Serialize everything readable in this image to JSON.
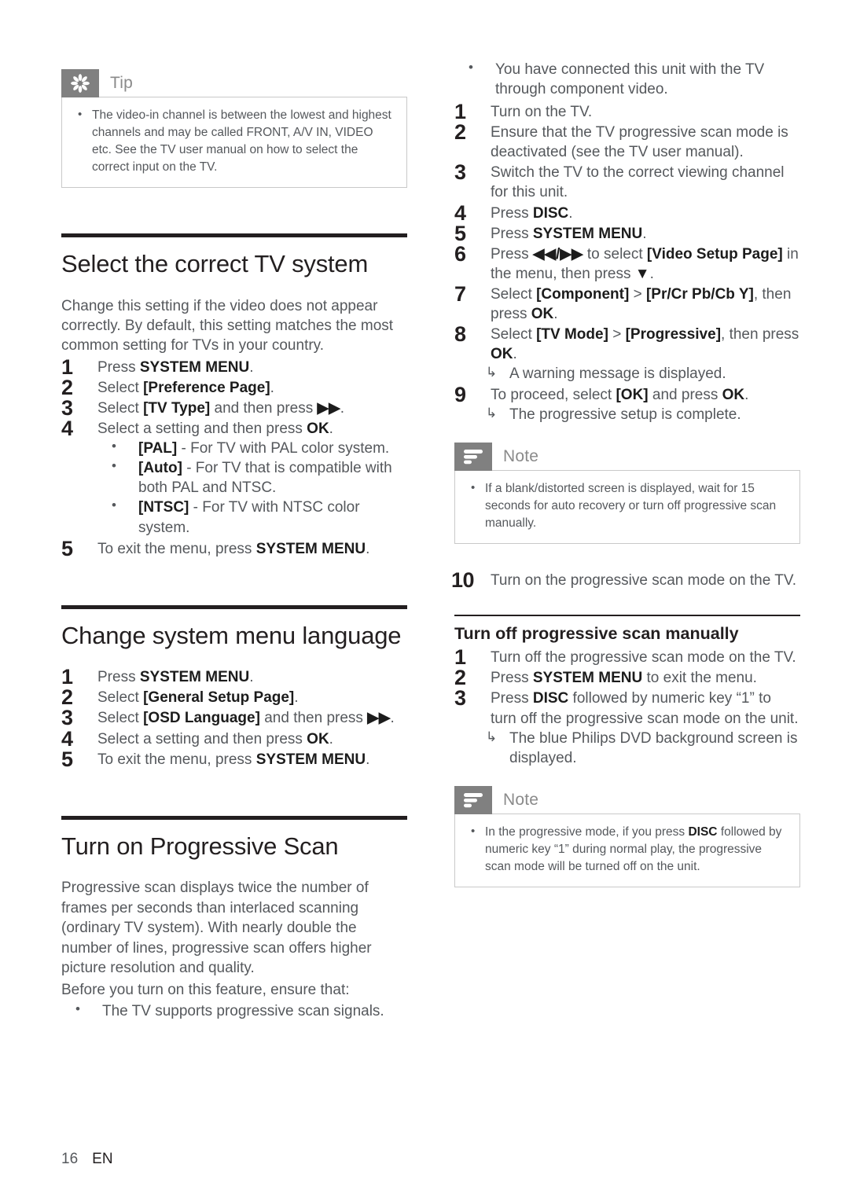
{
  "page": {
    "number": "16",
    "language": "EN"
  },
  "left_column": {
    "tip_box": {
      "icon": "asterisk-flower-icon",
      "title": "Tip",
      "items": [
        "The video-in channel is between the lowest and highest channels and may be called FRONT, A/V IN, VIDEO etc. See the TV user manual on how to select the correct input on the TV."
      ]
    },
    "section_tv_system": {
      "heading": "Select the correct TV system",
      "intro": "Change this setting if the video does not appear correctly. By default, this setting matches the most common setting for TVs in your country.",
      "steps": [
        {
          "num": "1",
          "text_html": "Press <b>SYSTEM MENU</b>."
        },
        {
          "num": "2",
          "text_html": "Select <b>[Preference Page]</b>."
        },
        {
          "num": "3",
          "text_html": "Select <b>[TV Type]</b> and then press <b>▶▶</b>."
        },
        {
          "num": "4",
          "text_html": "Select a setting and then press <b>OK</b>."
        },
        {
          "num": "5",
          "text_html": "To exit the menu, press <b>SYSTEM MENU</b>."
        }
      ],
      "step4_bullets": [
        "<b>[PAL]</b> - For TV with PAL color system.",
        "<b>[Auto]</b> - For TV that is compatible with both PAL and NTSC.",
        "<b>[NTSC]</b> - For TV with NTSC color system."
      ]
    },
    "section_menu_language": {
      "heading": "Change system menu language",
      "steps": [
        {
          "num": "1",
          "text_html": "Press <b>SYSTEM MENU</b>."
        },
        {
          "num": "2",
          "text_html": "Select <b>[General Setup Page]</b>."
        },
        {
          "num": "3",
          "text_html": "Select <b>[OSD Language]</b> and then press <b>▶▶</b>."
        },
        {
          "num": "4",
          "text_html": "Select a setting and then press <b>OK</b>."
        },
        {
          "num": "5",
          "text_html": "To exit the menu, press <b>SYSTEM MENU</b>."
        }
      ]
    },
    "section_progressive_scan": {
      "heading": "Turn on Progressive Scan",
      "intro": "Progressive scan displays twice the number of frames per seconds than interlaced scanning (ordinary TV system). With nearly double the number of lines, progressive scan offers higher picture resolution and quality.",
      "intro2": "Before you turn on this feature, ensure that:",
      "bullets": [
        "The TV supports progressive scan signals."
      ]
    }
  },
  "right_column": {
    "continued_bullets": [
      "You have connected this unit with the TV through component video."
    ],
    "steps": [
      {
        "num": "1",
        "text_html": "Turn on the TV."
      },
      {
        "num": "2",
        "text_html": "Ensure that the TV progressive scan mode is deactivated (see the TV user manual)."
      },
      {
        "num": "3",
        "text_html": "Switch the TV to the correct viewing channel for this unit."
      },
      {
        "num": "4",
        "text_html": "Press <b>DISC</b>."
      },
      {
        "num": "5",
        "text_html": "Press <b>SYSTEM MENU</b>."
      },
      {
        "num": "6",
        "text_html": "Press <b>◀◀/▶▶</b> to select <b>[Video Setup Page]</b> in the menu, then press <b>▼</b>."
      },
      {
        "num": "7",
        "text_html": "Select <b>[Component]</b> > <b>[Pr/Cr Pb/Cb Y]</b>, then press <b>OK</b>."
      },
      {
        "num": "8",
        "text_html": "Select <b>[TV Mode]</b> > <b>[Progressive]</b>, then press <b>OK</b>."
      },
      {
        "num": "9",
        "text_html": "To proceed, select <b>[OK]</b> and press <b>OK</b>."
      }
    ],
    "step8_result": "A warning message is displayed.",
    "step9_result": "The progressive setup is complete.",
    "note_box_1": {
      "icon": "note-lines-icon",
      "title": "Note",
      "items": [
        "If a blank/distorted screen is displayed, wait for 15 seconds for auto recovery or turn off progressive scan manually."
      ]
    },
    "step10": {
      "num": "10",
      "text_html": "Turn on the progressive scan mode on the TV."
    },
    "section_turn_off": {
      "heading": "Turn off progressive scan manually",
      "steps": [
        {
          "num": "1",
          "text_html": "Turn off the progressive scan mode on the TV."
        },
        {
          "num": "2",
          "text_html": "Press <b>SYSTEM MENU</b> to exit the menu."
        },
        {
          "num": "3",
          "text_html": "Press <b>DISC</b> followed by numeric key “1” to turn off the progressive scan mode on the unit."
        }
      ],
      "step3_result": "The blue Philips DVD background screen is displayed."
    },
    "note_box_2": {
      "icon": "note-lines-icon",
      "title": "Note",
      "items": [
        "In the progressive mode, if you press <b>DISC</b> followed by numeric key “1” during normal play, the progressive scan mode will be turned off on the unit."
      ]
    }
  },
  "colors": {
    "heading": "#231f20",
    "body_text": "#55585c",
    "callout_icon_bg": "#808080",
    "callout_border": "#c9c9c9",
    "callout_title": "#8a8a8a"
  }
}
